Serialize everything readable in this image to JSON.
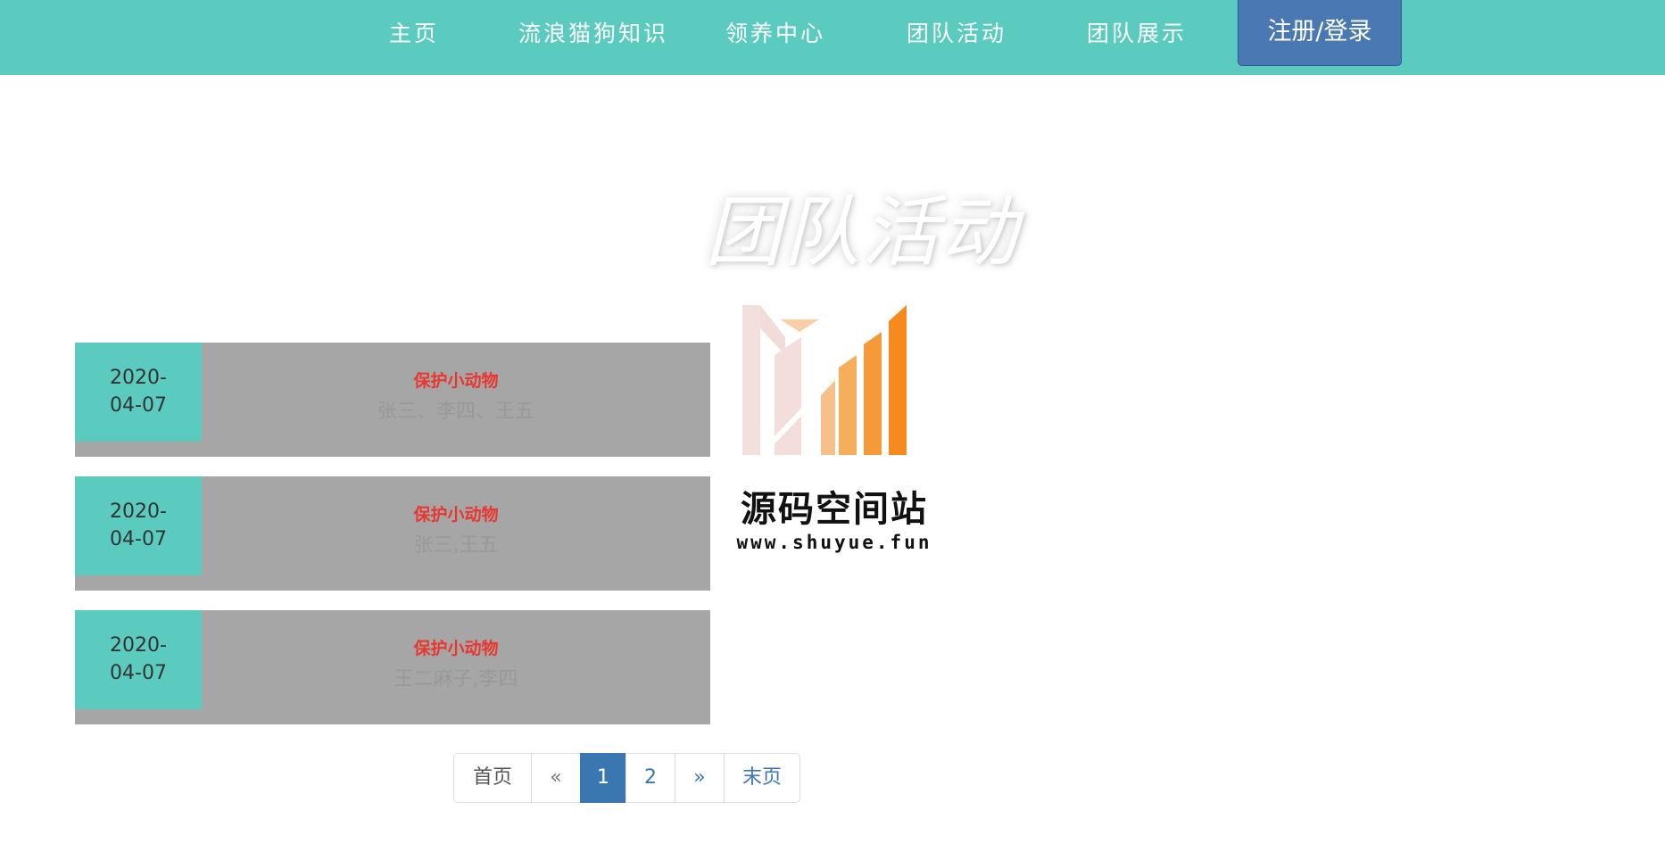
{
  "nav": {
    "items": [
      {
        "label": "主页"
      },
      {
        "label": "流浪猫狗知识"
      },
      {
        "label": "领养中心"
      },
      {
        "label": "团队活动"
      },
      {
        "label": "团队展示"
      }
    ],
    "login_label": "注册/登录"
  },
  "section": {
    "title": "团队活动"
  },
  "activities": [
    {
      "date_line1": "2020-",
      "date_line2": "04-07",
      "title": "保护小动物",
      "members": "张三、李四、王五"
    },
    {
      "date_line1": "2020-",
      "date_line2": "04-07",
      "title": "保护小动物",
      "members": "张三,王五"
    },
    {
      "date_line1": "2020-",
      "date_line2": "04-07",
      "title": "保护小动物",
      "members": "王二麻子,李四"
    }
  ],
  "watermark": {
    "name": "源码空间站",
    "url": "www.shuyue.fun"
  },
  "pagination": {
    "first": "首页",
    "prev": "«",
    "pages": [
      "1",
      "2"
    ],
    "current": "1",
    "next": "»",
    "last": "末页"
  },
  "colors": {
    "nav_bg": "#5bcbbf",
    "login_bg": "#4a78b3",
    "card_bg": "#a6a6a6",
    "date_bg": "#5bcbbf",
    "title_red": "#e8372f",
    "page_active": "#3a76b0"
  }
}
